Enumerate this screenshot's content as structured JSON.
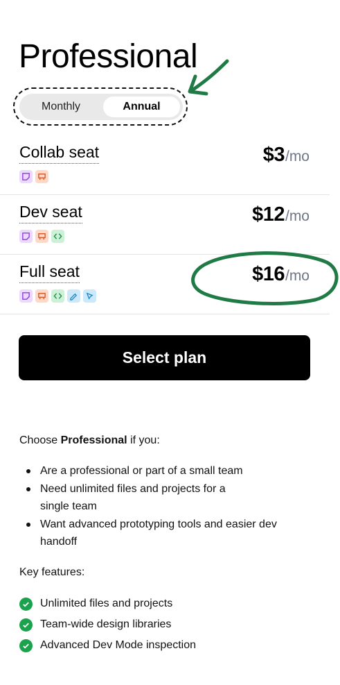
{
  "plan": {
    "title": "Professional"
  },
  "billing_toggle": {
    "options": [
      "Monthly",
      "Annual"
    ],
    "selected": "Annual"
  },
  "seats": [
    {
      "name": "Collab seat",
      "price": "$3",
      "unit": "/mo",
      "icons": [
        "figjam-icon",
        "slides-icon"
      ]
    },
    {
      "name": "Dev seat",
      "price": "$12",
      "unit": "/mo",
      "icons": [
        "figjam-icon",
        "slides-icon",
        "dev-mode-icon"
      ]
    },
    {
      "name": "Full seat",
      "price": "$16",
      "unit": "/mo",
      "icons": [
        "figjam-icon",
        "slides-icon",
        "dev-mode-icon",
        "draw-icon",
        "design-icon"
      ]
    }
  ],
  "cta": {
    "label": "Select plan"
  },
  "choose": {
    "prefix": "Choose ",
    "plan": "Professional",
    "suffix": " if you:"
  },
  "reasons": [
    "Are a professional or part of a small team",
    "Need unlimited files and projects for a single team",
    "Want advanced prototyping tools and easier dev handoff"
  ],
  "key_features": {
    "title": "Key features:",
    "items": [
      "Unlimited files and projects",
      "Team-wide design libraries",
      "Advanced Dev Mode inspection"
    ]
  },
  "colors": {
    "accent_green": "#1aa24d",
    "annotation_green": "#1f7a45",
    "price_unit": "#6c7687"
  }
}
